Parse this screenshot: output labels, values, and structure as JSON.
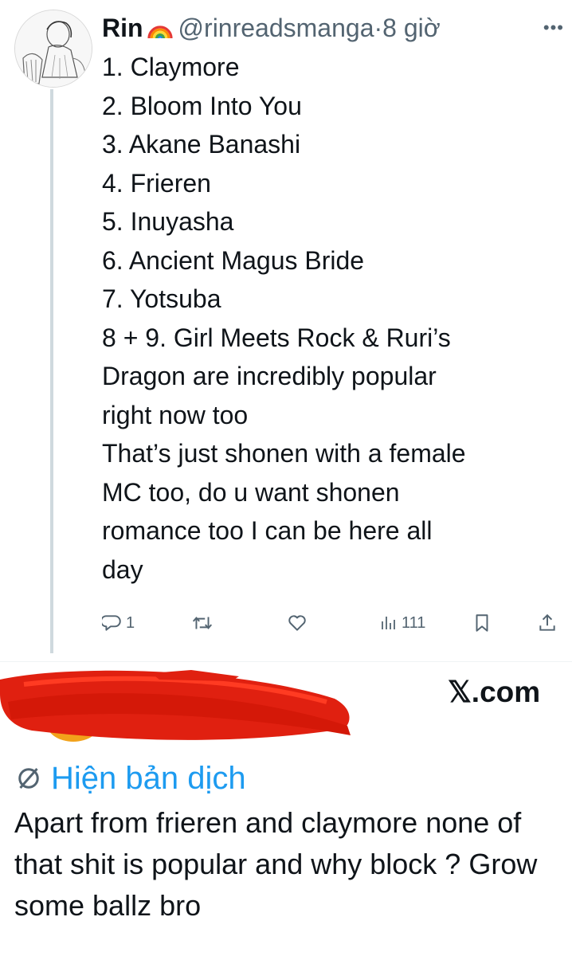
{
  "tweet": {
    "author_name": "Rin",
    "author_emoji": "🌈",
    "author_handle": "@rinreadsmanga",
    "separator": "·",
    "time": "8 giờ",
    "more_icon": "more-horizontal-icon",
    "avatar": "manga-sketch-avatar",
    "lines": [
      "1. Claymore",
      "2. Bloom Into You",
      "3. Akane Banashi",
      "4. Frieren",
      "5. Inuyasha",
      "6. Ancient Magus Bride",
      "7. Yotsuba",
      "8 + 9. Girl Meets Rock & Ruri’s",
      "Dragon are incredibly popular",
      "right now too",
      "That’s just shonen with a female",
      "MC too, do u want shonen",
      "romance too I can be here all",
      "day"
    ],
    "actions": {
      "reply_count": "1",
      "retweet_count": "",
      "like_count": "",
      "view_count": "111",
      "icons": [
        "reply-icon",
        "retweet-icon",
        "like-icon",
        "views-icon",
        "bookmark-icon",
        "share-icon"
      ]
    }
  },
  "watermark": {
    "brand": "𝕏.com"
  },
  "reply": {
    "redaction_color": "#e02010",
    "translate_label": "Hiện bản dịch",
    "translate_icon": "translate-icon",
    "text": "Apart from frieren and claymore none of that shit is popular and why block ? Grow some ballz bro"
  },
  "colors": {
    "text": "#0f1419",
    "secondary": "#536471",
    "accent": "#1d9bf0",
    "thread_line": "#cfd9de"
  }
}
